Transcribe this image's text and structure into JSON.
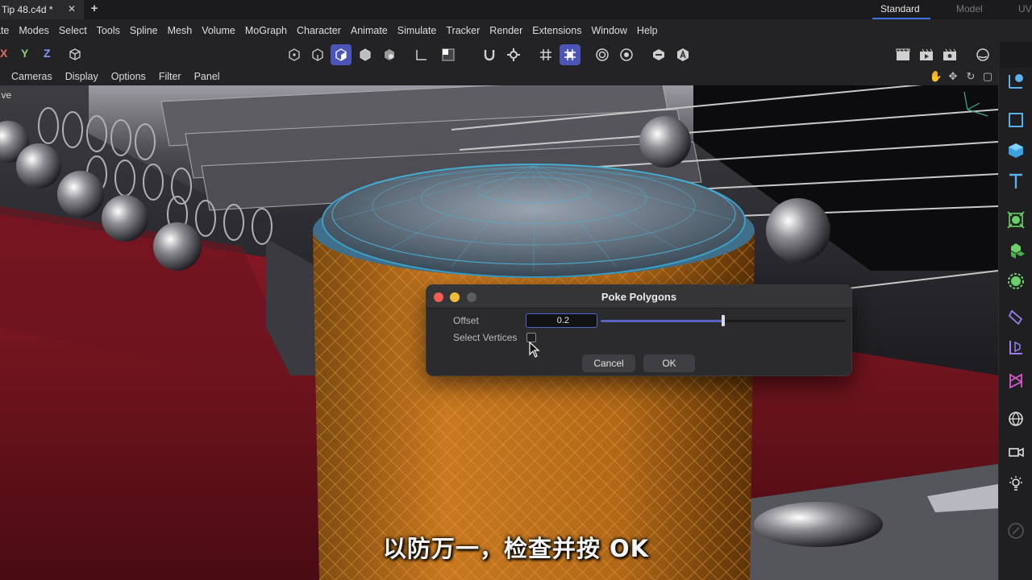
{
  "tabs": {
    "document": "Tip 48.c4d *",
    "close_glyph": "✕",
    "add_glyph": "+",
    "layouts": [
      "Standard",
      "Model",
      "UV"
    ]
  },
  "menu": [
    "ate",
    "Modes",
    "Select",
    "Tools",
    "Spline",
    "Mesh",
    "Volume",
    "MoGraph",
    "Character",
    "Animate",
    "Simulate",
    "Tracker",
    "Render",
    "Extensions",
    "Window",
    "Help"
  ],
  "toolbar": {
    "axes": [
      "X",
      "Y",
      "Z"
    ],
    "axis_colors": [
      "#e06b6b",
      "#8fd07a",
      "#7f9bff"
    ]
  },
  "viewport_menu": [
    "Cameras",
    "Display",
    "Options",
    "Filter",
    "Panel"
  ],
  "viewport": {
    "corner_text": "ve"
  },
  "dialog": {
    "title": "Poke Polygons",
    "offset_label": "Offset",
    "offset_value": "0.2",
    "offset_fraction": 0.5,
    "select_vertices_label": "Select Vertices",
    "select_vertices_checked": false,
    "cancel_label": "Cancel",
    "ok_label": "OK"
  },
  "subtitle": "以防万一，检查并按 OK",
  "colors": {
    "accent": "#4b55b8",
    "mesh_orange": "#e8902a",
    "mesh_cyan": "#3aa0c8",
    "guitar_red": "#7a1520"
  }
}
